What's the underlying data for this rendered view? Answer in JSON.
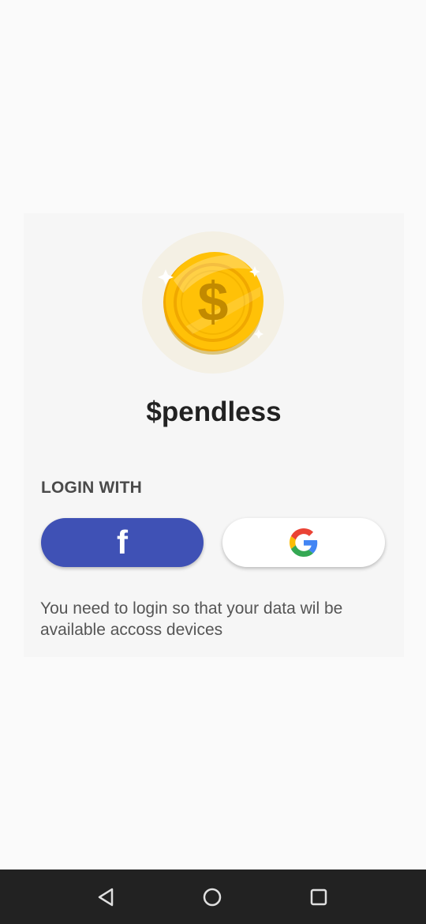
{
  "app": {
    "title": "$pendless",
    "logo_icon": "gold-dollar-coin-icon"
  },
  "login": {
    "label": "LOGIN WITH",
    "facebook": {
      "icon": "facebook-icon",
      "glyph": "f",
      "color": "#3f51b5"
    },
    "google": {
      "icon": "google-icon"
    },
    "note": "You need to login so that your data wil be available accoss devices"
  },
  "navbar": {
    "back_icon": "back-triangle-icon",
    "home_icon": "home-circle-icon",
    "recents_icon": "recents-square-icon"
  },
  "colors": {
    "background": "#fafafa",
    "card": "#f6f6f6",
    "facebook_blue": "#3f51b5",
    "coin_gold": "#ffc107",
    "navbar": "#222222"
  }
}
